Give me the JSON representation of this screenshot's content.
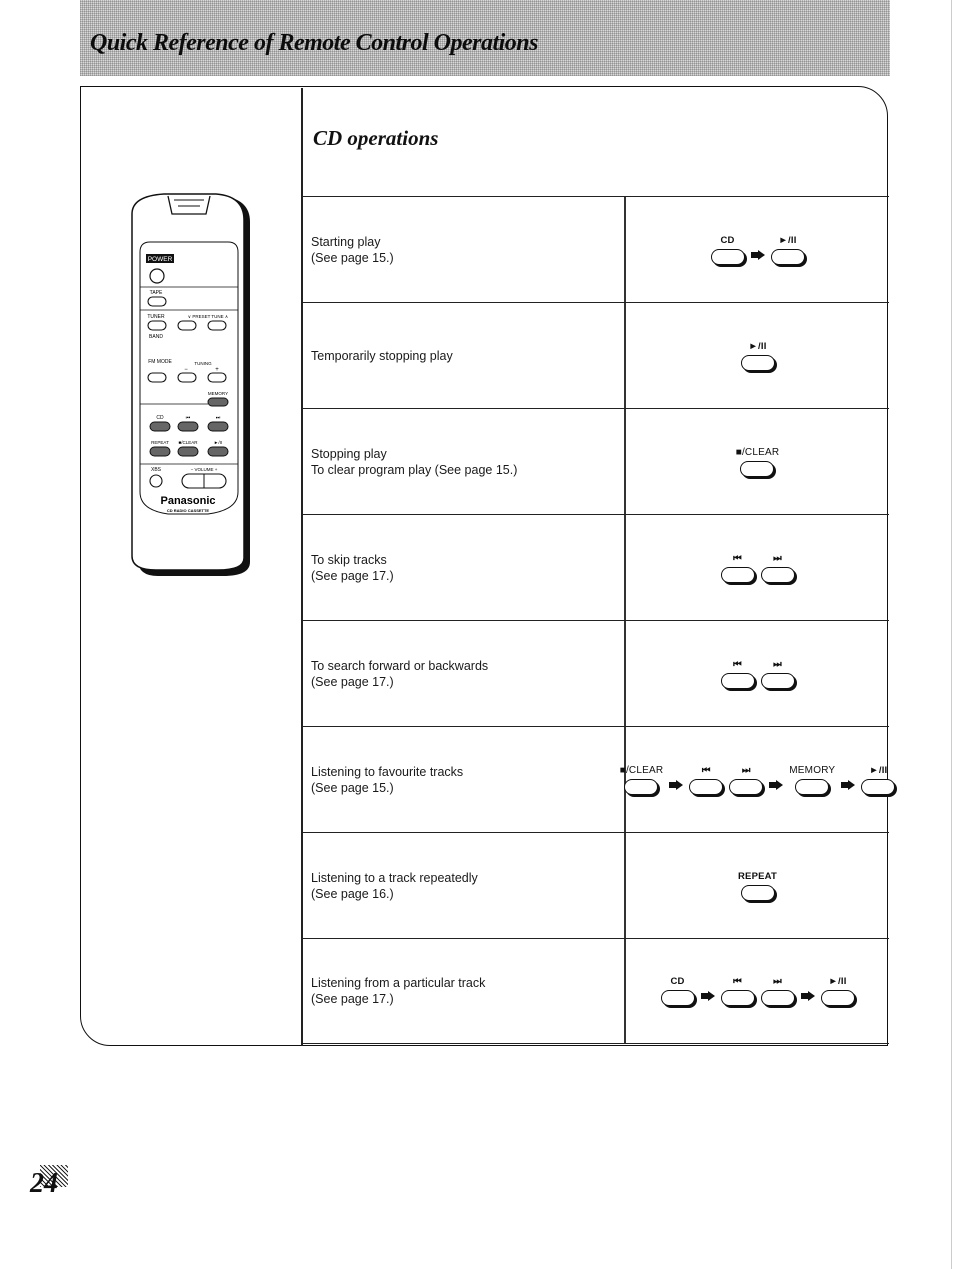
{
  "header": {
    "title": "Quick Reference of Remote Control Operations"
  },
  "section": {
    "title": "CD operations"
  },
  "remote": {
    "brand": "Panasonic",
    "model_label": "CD RADIO CASSETTE",
    "buttons": {
      "power": "POWER",
      "tape": "TAPE",
      "tuner": "TUNER",
      "band": "BAND",
      "preset_tune": "∨ PRESET TUNE ∧",
      "fm_mode": "FM MODE",
      "tuning": "TUNING",
      "tuning_minus": "−",
      "tuning_plus": "+",
      "memory": "MEMORY",
      "cd": "CD",
      "skip_back": "⏮",
      "skip_fwd": "⏭",
      "repeat": "REPEAT",
      "stop_clear": "■/CLEAR",
      "play_pause": "►/II",
      "xbs": "XBS",
      "volume": "− VOLUME +"
    }
  },
  "operations": [
    {
      "line1": "Starting play",
      "line2": "(See page 15.)",
      "sequence": [
        {
          "type": "button",
          "label": "CD"
        },
        {
          "type": "arrow"
        },
        {
          "type": "button",
          "label": "►/II"
        }
      ]
    },
    {
      "line1": "Temporarily stopping play",
      "line2": "",
      "sequence": [
        {
          "type": "button",
          "label": "►/II"
        }
      ]
    },
    {
      "line1": "Stopping play",
      "line2": "To clear program play (See page 15.)",
      "sequence": [
        {
          "type": "button",
          "label": "■/CLEAR"
        }
      ]
    },
    {
      "line1": "To skip tracks",
      "line2": "(See page 17.)",
      "sequence": [
        {
          "type": "button",
          "label": "⏮"
        },
        {
          "type": "button",
          "label": "⏭"
        }
      ]
    },
    {
      "line1": "To search forward or backwards",
      "line2": "(See page 17.)",
      "sequence": [
        {
          "type": "button",
          "label": "⏮"
        },
        {
          "type": "button",
          "label": "⏭"
        }
      ]
    },
    {
      "line1": "Listening to favourite tracks",
      "line2": "(See page 15.)",
      "sequence": [
        {
          "type": "button",
          "label": "■/CLEAR"
        },
        {
          "type": "arrow"
        },
        {
          "type": "button",
          "label": "⏮"
        },
        {
          "type": "button",
          "label": "⏭"
        },
        {
          "type": "arrow"
        },
        {
          "type": "button",
          "label": "MEMORY"
        },
        {
          "type": "arrow"
        },
        {
          "type": "button",
          "label": "►/II"
        }
      ]
    },
    {
      "line1": "Listening to a track repeatedly",
      "line2": "(See page 16.)",
      "sequence": [
        {
          "type": "button",
          "label": "REPEAT"
        }
      ]
    },
    {
      "line1": "Listening from a particular track",
      "line2": "(See page 17.)",
      "sequence": [
        {
          "type": "button",
          "label": "CD"
        },
        {
          "type": "arrow"
        },
        {
          "type": "button",
          "label": "⏮"
        },
        {
          "type": "button",
          "label": "⏭"
        },
        {
          "type": "arrow"
        },
        {
          "type": "button",
          "label": "►/II"
        }
      ]
    }
  ],
  "footer": {
    "page_number": "24"
  }
}
